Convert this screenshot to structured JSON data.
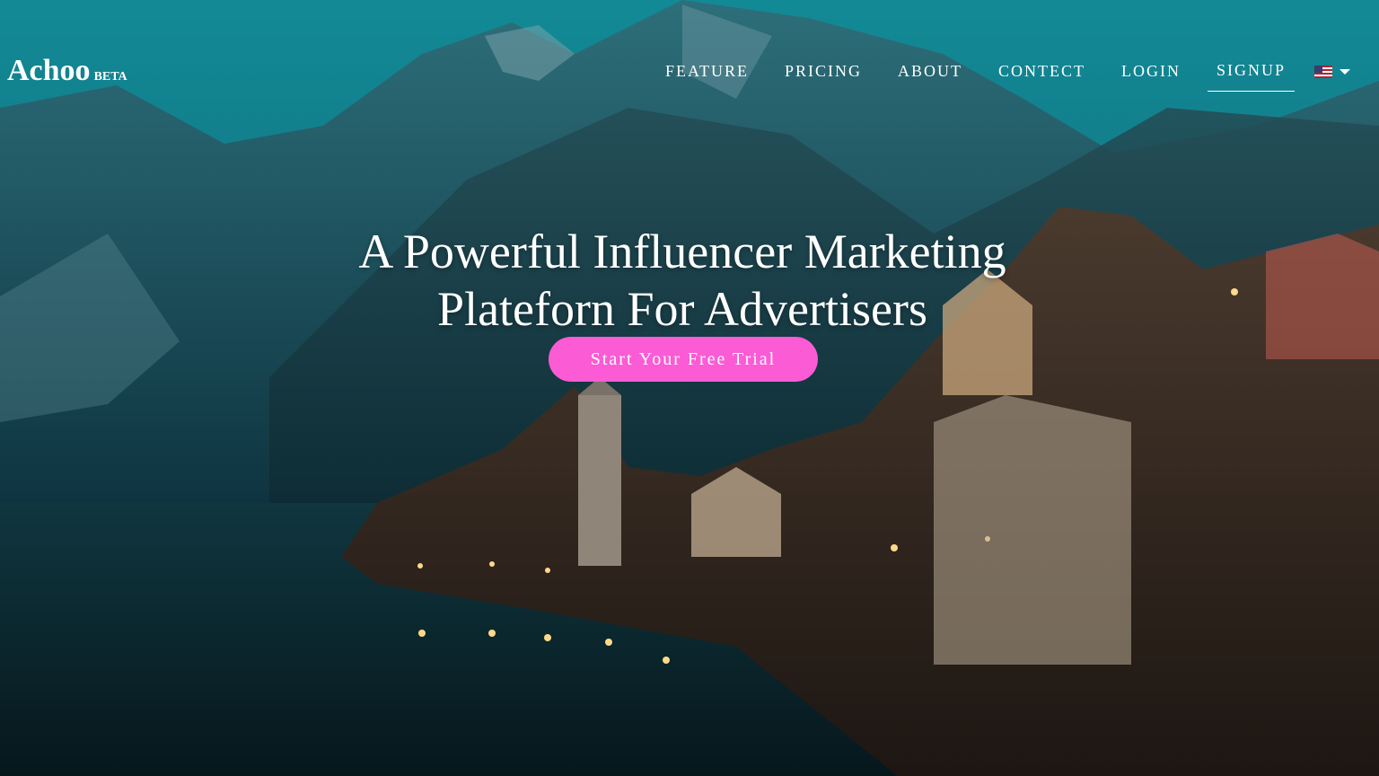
{
  "brand": {
    "name": "Achoo",
    "badge": "BETA"
  },
  "nav": {
    "items": [
      {
        "label": "FEATURE"
      },
      {
        "label": "PRICING"
      },
      {
        "label": "ABOUT"
      },
      {
        "label": "CONTECT"
      },
      {
        "label": "LOGIN"
      },
      {
        "label": "SIGNUP"
      }
    ],
    "active": "SIGNUP",
    "language_icon": "us-flag-icon"
  },
  "hero": {
    "headline_line1": "A Powerful Influencer Marketing",
    "headline_line2": "Plateforn For Advertisers",
    "cta_label": "Start Your Free Trial"
  },
  "colors": {
    "cta_background": "#fb5bd5",
    "text": "#ffffff",
    "sky": "#128a96"
  }
}
